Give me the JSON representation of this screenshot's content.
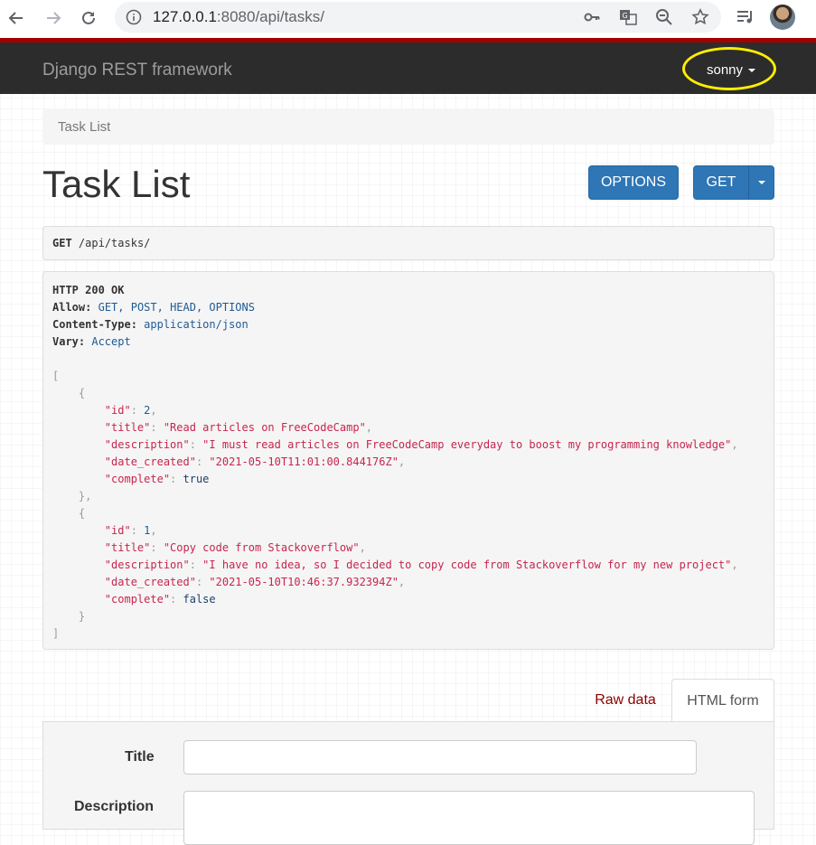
{
  "browser": {
    "url_host": "127.0.0.1",
    "url_rest": ":8080/api/tasks/"
  },
  "navbar": {
    "brand": "Django REST framework",
    "user": "sonny"
  },
  "breadcrumb": "Task List",
  "page_title": "Task List",
  "buttons": {
    "options": "OPTIONS",
    "get": "GET"
  },
  "request": {
    "method": "GET",
    "path": "/api/tasks/"
  },
  "response": {
    "status": "HTTP 200 OK",
    "headers": [
      {
        "name": "Allow:",
        "value": "GET, POST, HEAD, OPTIONS"
      },
      {
        "name": "Content-Type:",
        "value": "application/json"
      },
      {
        "name": "Vary:",
        "value": "Accept"
      }
    ],
    "tasks": [
      {
        "id": "2",
        "title": "\"Read articles on FreeCodeCamp\"",
        "description": "\"I must read articles on FreeCodeCamp everyday to boost my programming knowledge\"",
        "date_created": "\"2021-05-10T11:01:00.844176Z\"",
        "complete": "true"
      },
      {
        "id": "1",
        "title": "\"Copy code from Stackoverflow\"",
        "description": "\"I have no idea, so I decided to copy code from Stackoverflow for my new project\"",
        "date_created": "\"2021-05-10T10:46:37.932394Z\"",
        "complete": "false"
      }
    ],
    "keys": {
      "id": "\"id\"",
      "title": "\"title\"",
      "description": "\"description\"",
      "date_created": "\"date_created\"",
      "complete": "\"complete\""
    }
  },
  "tabs": {
    "raw": "Raw data",
    "html": "HTML form"
  },
  "form": {
    "title_label": "Title",
    "description_label": "Description"
  },
  "colors": {
    "navbar": "#2c2c2c",
    "navbar_accent": "#a30000",
    "primary": "#2e76b5",
    "json_string": "#c7254e",
    "highlight_ring": "#ffee00"
  }
}
